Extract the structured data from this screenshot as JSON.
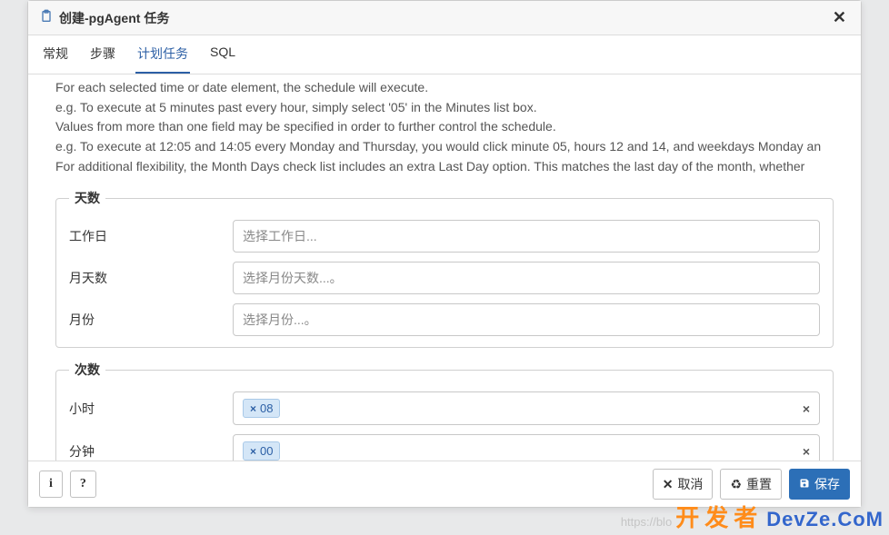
{
  "dialog": {
    "title": "创建-pgAgent 任务"
  },
  "tabs": {
    "general": "常规",
    "steps": "步骤",
    "schedule": "计划任务",
    "sql": "SQL"
  },
  "description": {
    "l1": "For each selected time or date element, the schedule will execute.",
    "l2": "e.g. To execute at 5 minutes past every hour, simply select '05' in the Minutes list box.",
    "l3": "Values from more than one field may be specified in order to further control the schedule.",
    "l4": "e.g. To execute at 12:05 and 14:05 every Monday and Thursday, you would click minute 05, hours 12 and 14, and weekdays Monday an",
    "l5": "For additional flexibility, the Month Days check list includes an extra Last Day option. This matches the last day of the month, whether"
  },
  "fieldset_days": {
    "legend": "天数",
    "weekday_label": "工作日",
    "weekday_placeholder": "选择工作日...",
    "monthday_label": "月天数",
    "monthday_placeholder": "选择月份天数...。",
    "month_label": "月份",
    "month_placeholder": "选择月份...。"
  },
  "fieldset_times": {
    "legend": "次数",
    "hour_label": "小时",
    "hour_tag": "08",
    "minute_label": "分钟",
    "minute_tag": "00"
  },
  "footer": {
    "info": "i",
    "help": "?",
    "cancel": "取消",
    "reset": "重置",
    "save": "保存"
  },
  "watermark": {
    "url": "https://blo",
    "cn": "开发者",
    "en": "DevZe.CoM"
  },
  "glyph": {
    "x": "×",
    "x_bold": "✕"
  }
}
